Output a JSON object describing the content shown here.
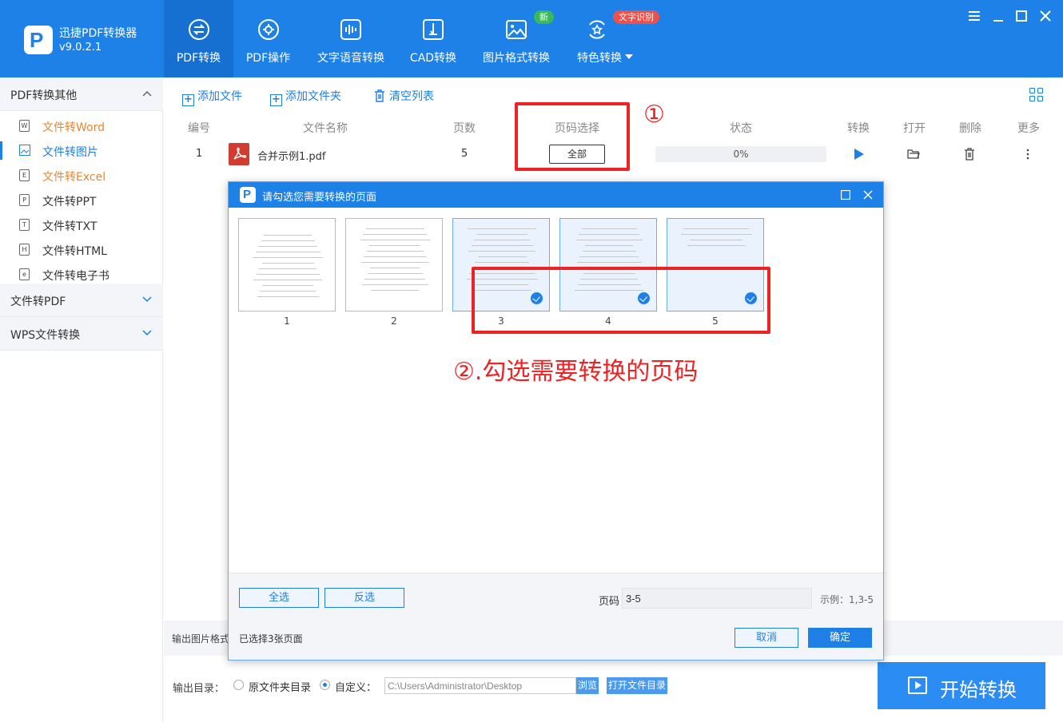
{
  "app": {
    "name": "迅捷PDF转换器",
    "version": "v9.0.2.1",
    "logo_letter": "P"
  },
  "nav": {
    "tabs": [
      {
        "label": "PDF转换",
        "icon": "convert-icon"
      },
      {
        "label": "PDF操作",
        "icon": "gear-circle-icon"
      },
      {
        "label": "文字语音转换",
        "icon": "waveform-icon"
      },
      {
        "label": "CAD转换",
        "icon": "cad-icon"
      },
      {
        "label": "图片格式转换",
        "icon": "image-icon"
      },
      {
        "label": "特色转换",
        "icon": "star-refresh-icon"
      }
    ],
    "badge_new": "新",
    "badge_ocr": "文字识别"
  },
  "sidebar": {
    "group1": "PDF转换其他",
    "items": [
      {
        "label": "文件转Word",
        "icon_text": "W"
      },
      {
        "label": "文件转图片",
        "icon_text": ""
      },
      {
        "label": "文件转Excel",
        "icon_text": "E"
      },
      {
        "label": "文件转PPT",
        "icon_text": "P"
      },
      {
        "label": "文件转TXT",
        "icon_text": "T"
      },
      {
        "label": "文件转HTML",
        "icon_text": "H"
      },
      {
        "label": "文件转电子书",
        "icon_text": "e"
      }
    ],
    "group2": "文件转PDF",
    "group3": "WPS文件转换"
  },
  "toolbar": {
    "add_file": "添加文件",
    "add_folder": "添加文件夹",
    "clear_list": "清空列表"
  },
  "table": {
    "headers": [
      "编号",
      "文件名称",
      "页数",
      "页码选择",
      "状态",
      "转换",
      "打开",
      "删除",
      "更多"
    ],
    "rows": [
      {
        "index": "1",
        "filename": "合并示例1.pdf",
        "pages": "5",
        "page_select": "全部",
        "status": "0%"
      }
    ]
  },
  "annotations": {
    "circle_one": "①",
    "step_two": "②.勾选需要转换的页码"
  },
  "dialog": {
    "title": "请勾选您需要转换的页面",
    "pages": [
      {
        "num": "1",
        "selected": false
      },
      {
        "num": "2",
        "selected": false
      },
      {
        "num": "3",
        "selected": true
      },
      {
        "num": "4",
        "selected": true
      },
      {
        "num": "5",
        "selected": true
      }
    ],
    "select_all": "全选",
    "invert": "反选",
    "page_label": "页码",
    "page_value": "3-5",
    "example": "示例：1,3-5",
    "selected_count": "已选择3张页面",
    "cancel": "取消",
    "confirm": "确定"
  },
  "bottom": {
    "output_format_label": "输出图片格式",
    "output_dir_label": "输出目录：",
    "radio_original": "原文件夹目录",
    "radio_custom": "自定义：",
    "custom_selected": true,
    "path": "C:\\Users\\Administrator\\Desktop",
    "browse": "浏览",
    "open_dir": "打开文件目录",
    "start": "开始转换"
  },
  "colors": {
    "primary": "#1e81e8",
    "annotation_red": "#ee2222",
    "orange": "#e8862e"
  }
}
